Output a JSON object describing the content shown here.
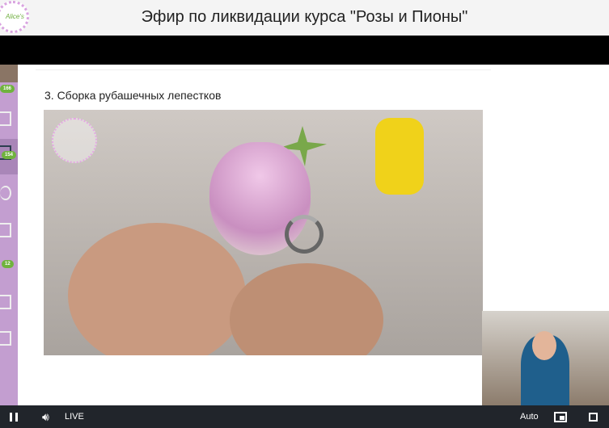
{
  "header": {
    "title": "Эфир по ликвидации курса \"Розы и Пионы\"",
    "logo_text": "Alice's"
  },
  "sidebar": {
    "badges": [
      "166",
      "154",
      "12"
    ]
  },
  "lesson": {
    "title": "3. Сборка рубашечных лепестков"
  },
  "player": {
    "live_label": "LIVE",
    "quality": "Auto"
  }
}
